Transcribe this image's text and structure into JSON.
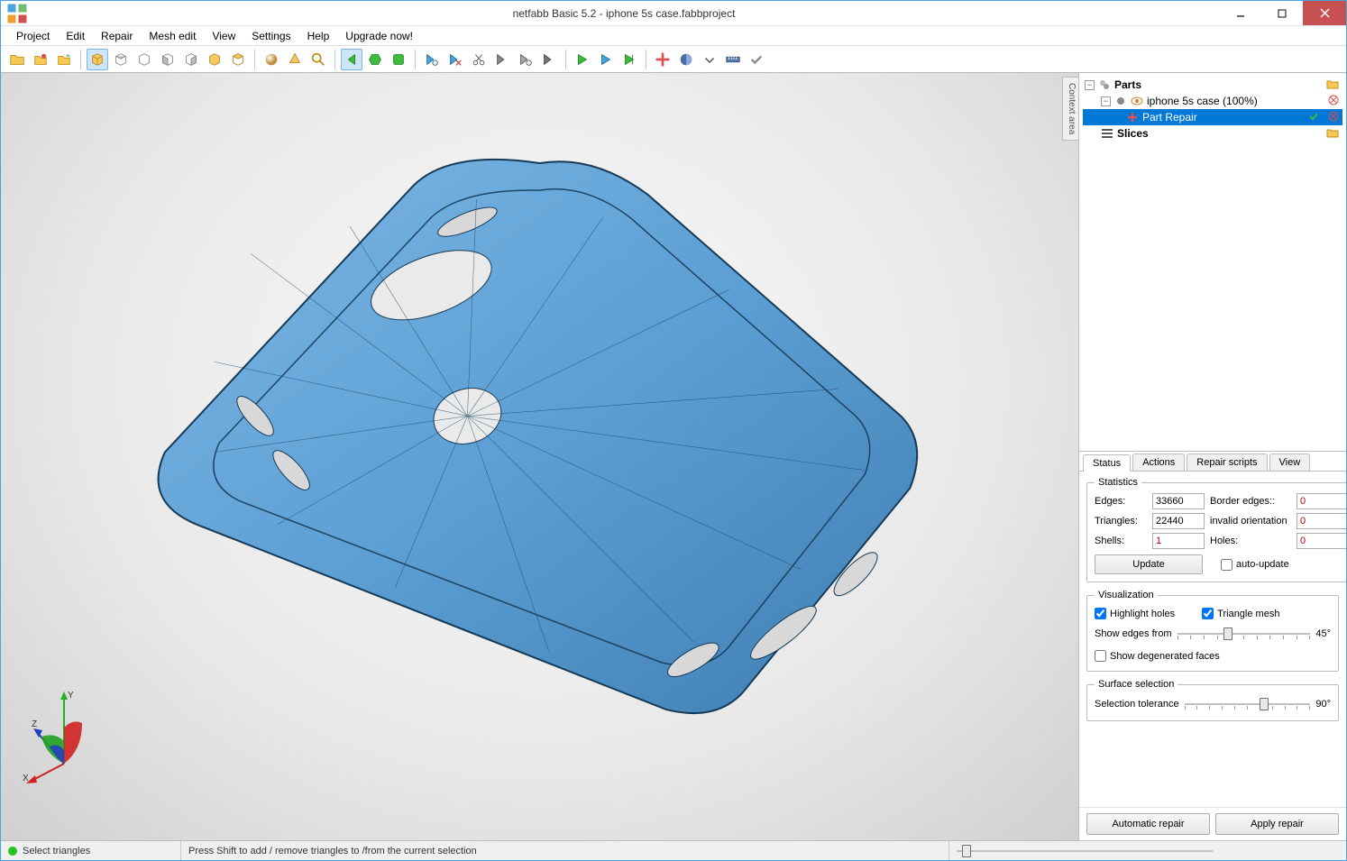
{
  "window": {
    "title": "netfabb Basic 5.2 - iphone 5s case.fabbproject"
  },
  "menu": [
    "Project",
    "Edit",
    "Repair",
    "Mesh edit",
    "View",
    "Settings",
    "Help",
    "Upgrade now!"
  ],
  "context_tab": "Context area",
  "tree": {
    "parts_label": "Parts",
    "part_item": "iphone 5s case (100%)",
    "repair_item": "Part Repair",
    "slices_label": "Slices"
  },
  "tabs": [
    "Status",
    "Actions",
    "Repair scripts",
    "View"
  ],
  "stats": {
    "legend": "Statistics",
    "edges_label": "Edges:",
    "edges": "33660",
    "border_label": "Border edges::",
    "border": "0",
    "triangles_label": "Triangles:",
    "triangles": "22440",
    "invorient_label": "invalid orientation",
    "invorient": "0",
    "shells_label": "Shells:",
    "shells": "1",
    "holes_label": "Holes:",
    "holes": "0",
    "update_btn": "Update",
    "autoupdate_label": "auto-update"
  },
  "viz": {
    "legend": "Visualization",
    "highlight_label": "Highlight holes",
    "trimesh_label": "Triangle mesh",
    "edges_from_label": "Show edges from",
    "edges_from_val": "45°",
    "degen_label": "Show degenerated faces"
  },
  "surface": {
    "legend": "Surface selection",
    "tolerance_label": "Selection tolerance",
    "tolerance_val": "90°"
  },
  "buttons": {
    "auto_repair": "Automatic repair",
    "apply_repair": "Apply repair"
  },
  "status": {
    "mode": "Select triangles",
    "hint": "Press Shift to add / remove triangles to /from the current selection"
  }
}
